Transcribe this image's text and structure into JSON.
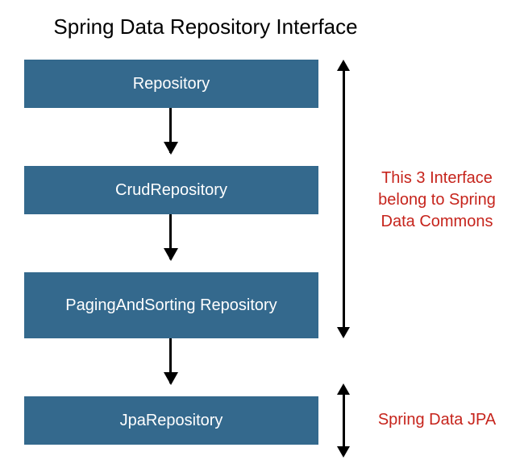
{
  "title": "Spring Data Repository Interface",
  "boxes": {
    "b1": "Repository",
    "b2": "CrudRepository",
    "b3": "PagingAndSorting Repository",
    "b4": "JpaRepository"
  },
  "annotations": {
    "commons": "This 3 Interface belong to Spring Data Commons",
    "jpa": "Spring Data JPA"
  },
  "colors": {
    "box_bg": "#34698d",
    "annotation_text": "#c6241c"
  }
}
